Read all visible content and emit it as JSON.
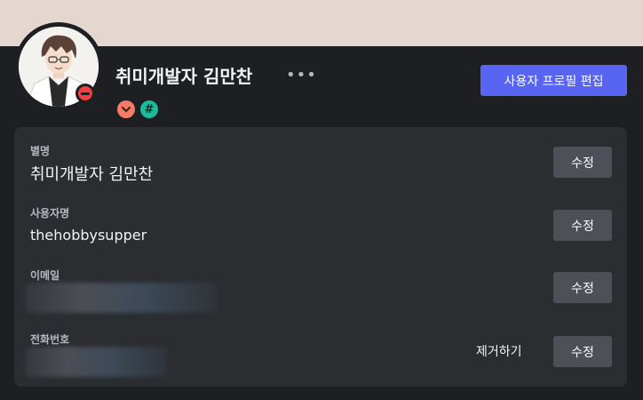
{
  "profile": {
    "display_name": "취미개발자 김만찬",
    "more_glyph": "•••",
    "edit_button": "사용자 프로필 편집",
    "status": "do-not-disturb",
    "badges": [
      {
        "icon": "chevron-down-badge-icon",
        "color": "#f47b67"
      },
      {
        "icon": "hash-badge-icon",
        "glyph": "#",
        "color": "#1abc9c"
      }
    ]
  },
  "fields": {
    "nickname": {
      "label": "별명",
      "value": "취미개발자 김만찬",
      "edit": "수정"
    },
    "username": {
      "label": "사용자명",
      "value": "thehobbysupper",
      "edit": "수정"
    },
    "email": {
      "label": "이메일",
      "edit": "수정"
    },
    "phone": {
      "label": "전화번호",
      "edit": "수정",
      "remove": "제거하기"
    }
  },
  "colors": {
    "banner": "#e4d7cf",
    "background": "#1e1f22",
    "card": "#2b2d31",
    "accent": "#5865f2",
    "secondary_button": "#4e5058",
    "status_dnd": "#f23f43"
  }
}
